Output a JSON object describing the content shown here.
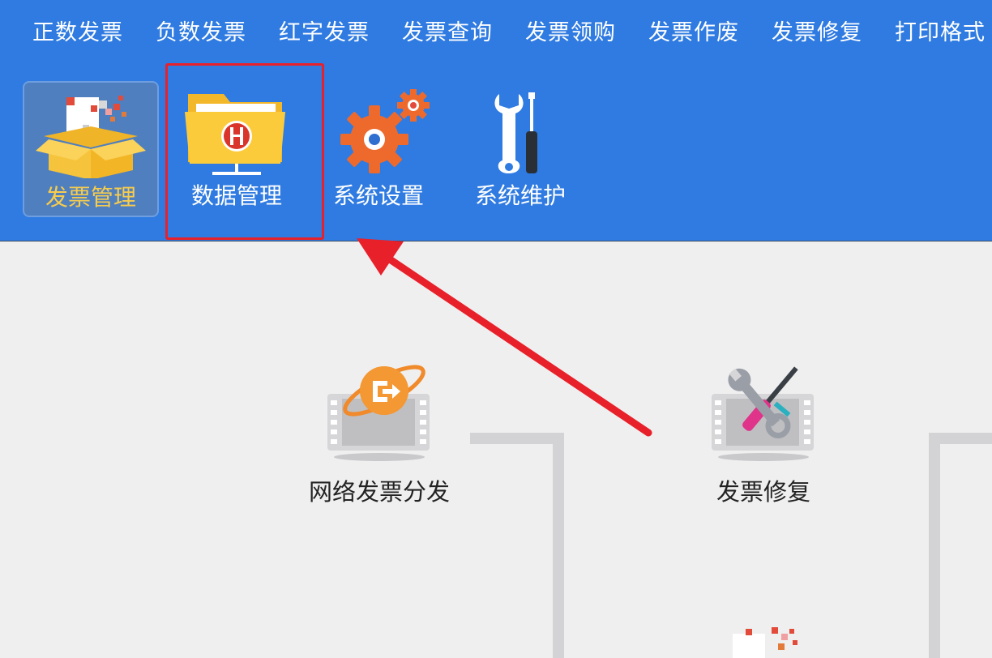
{
  "menu": {
    "items": [
      {
        "label": "正数发票"
      },
      {
        "label": "负数发票"
      },
      {
        "label": "红字发票"
      },
      {
        "label": "发票查询"
      },
      {
        "label": "发票领购"
      },
      {
        "label": "发票作废"
      },
      {
        "label": "发票修复"
      },
      {
        "label": "打印格式"
      }
    ]
  },
  "toolbar": {
    "items": [
      {
        "label": "发票管理",
        "icon": "open-box-invoice-icon",
        "active": true
      },
      {
        "label": "数据管理",
        "icon": "folder-network-icon",
        "active": false
      },
      {
        "label": "系统设置",
        "icon": "gears-icon",
        "active": false
      },
      {
        "label": "系统维护",
        "icon": "wrench-screwdriver-icon",
        "active": false
      }
    ]
  },
  "main": {
    "functions": [
      {
        "label": "网络发票分发",
        "icon": "network-distribute-icon"
      },
      {
        "label": "发票修复",
        "icon": "tools-repair-icon"
      }
    ]
  },
  "annotation": {
    "highlight_color": "#e8202a",
    "arrow_color": "#e8202a"
  },
  "colors": {
    "header_bg": "#2f7be1",
    "active_label": "#f7cc4d",
    "content_bg": "#efeff0"
  }
}
